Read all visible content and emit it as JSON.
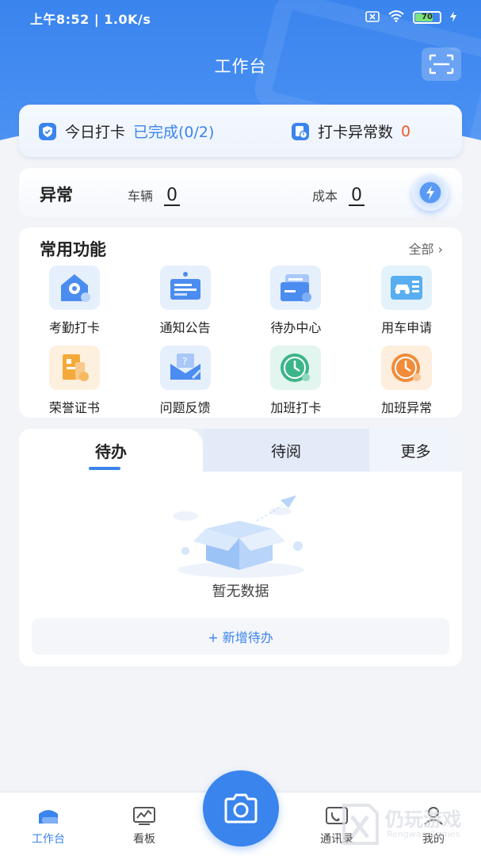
{
  "status_bar": {
    "time_speed": "上午8:52 | 1.0K/s",
    "battery": "70"
  },
  "header": {
    "title": "工作台"
  },
  "punch": {
    "today_label": "今日打卡",
    "today_status": "已完成(0/2)",
    "abnormal_label": "打卡异常数",
    "abnormal_count": "0"
  },
  "abnormal": {
    "title": "异常",
    "vehicle_label": "车辆",
    "vehicle_count": "0",
    "cost_label": "成本",
    "cost_count": "0"
  },
  "functions": {
    "title": "常用功能",
    "all_label": "全部 ›",
    "items": [
      {
        "label": "考勤打卡",
        "icon": "location-house-icon"
      },
      {
        "label": "通知公告",
        "icon": "notice-board-icon"
      },
      {
        "label": "待办中心",
        "icon": "todo-folder-icon"
      },
      {
        "label": "用车申请",
        "icon": "car-request-icon"
      },
      {
        "label": "荣誉证书",
        "icon": "certificate-icon"
      },
      {
        "label": "问题反馈",
        "icon": "feedback-envelope-icon"
      },
      {
        "label": "加班打卡",
        "icon": "overtime-clock-icon"
      },
      {
        "label": "加班异常",
        "icon": "overtime-abnormal-clock-icon"
      }
    ]
  },
  "tabs": {
    "items": [
      "待办",
      "待阅",
      "更多"
    ],
    "active": "待办"
  },
  "empty": {
    "text": "暂无数据"
  },
  "add_todo": {
    "label": "+ 新增待办"
  },
  "bottom_nav": {
    "items": [
      "工作台",
      "看板",
      "通讯录",
      "我的"
    ],
    "active": "工作台"
  },
  "watermark": {
    "text": "仍玩游戏",
    "sub": "Rengwan Games"
  },
  "colors": {
    "accent": "#3a84ee",
    "warning": "#f05a2a",
    "background": "#f2f4f8"
  }
}
